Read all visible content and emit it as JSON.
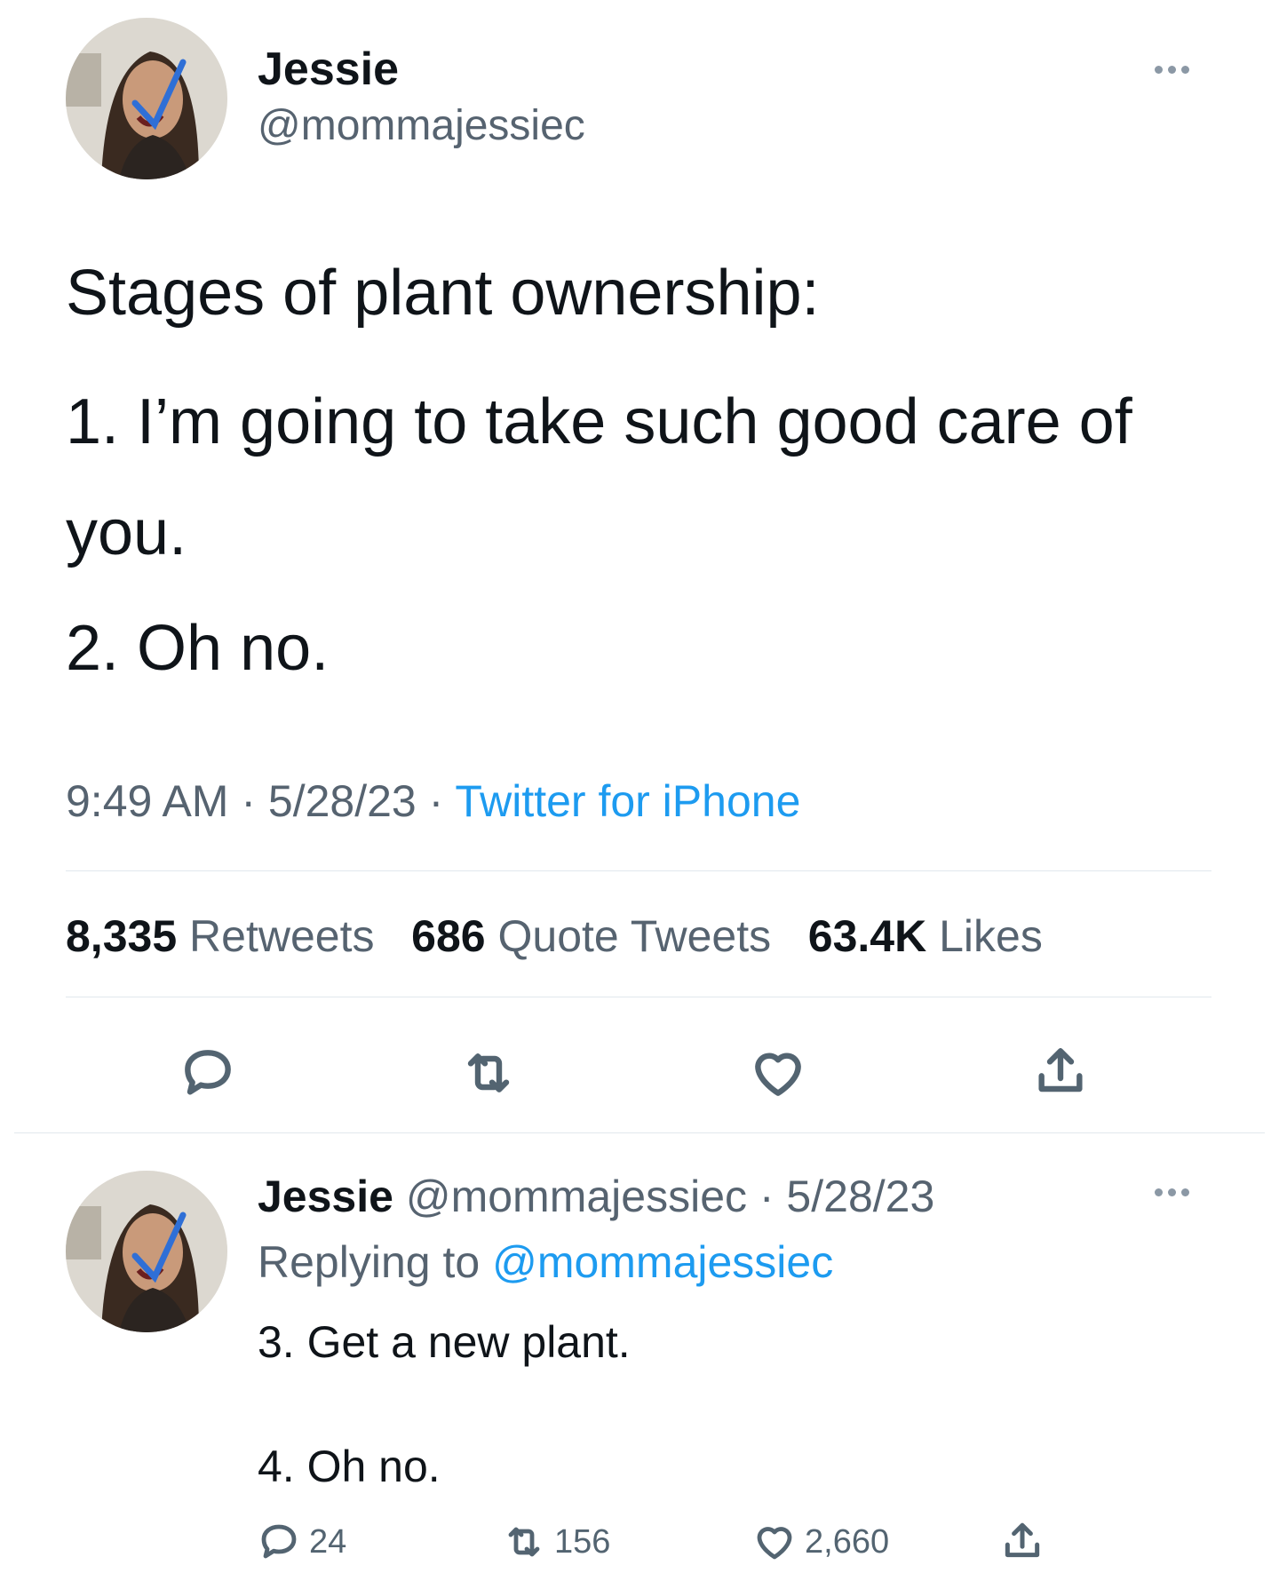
{
  "tweet": {
    "author_name": "Jessie",
    "author_handle": "@mommajessiec",
    "text_line1": "Stages of plant ownership:",
    "text_line2a": "1. I’m going to take such good care of",
    "text_line2b": "you.",
    "text_line3": "2. Oh no.",
    "time": "9:49 AM",
    "sep1": "·",
    "date": "5/28/23",
    "sep2": "·",
    "source": "Twitter for iPhone",
    "stats": {
      "retweets_count": "8,335",
      "retweets_label": "Retweets",
      "quotes_count": "686",
      "quotes_label": "Quote Tweets",
      "likes_count": "63.4K",
      "likes_label": "Likes"
    }
  },
  "reply": {
    "author_name": "Jessie",
    "meta": "@mommajessiec · 5/28/23",
    "replying_label": "Replying to",
    "replying_handle": "@mommajessiec",
    "text_line1": "3. Get a new plant.",
    "text_line2": "4. Oh no.",
    "reply_count": "24",
    "retweet_count": "156",
    "like_count": "2,660"
  },
  "icons": {
    "more": "more-dots-icon",
    "reply": "reply-bubble-icon",
    "retweet": "retweet-arrows-icon",
    "like": "heart-icon",
    "share": "share-upload-icon"
  },
  "colors": {
    "link_blue": "#1d9bf0",
    "secondary_gray": "#566370",
    "text": "#0f1419",
    "divider": "#e1e8ed"
  }
}
